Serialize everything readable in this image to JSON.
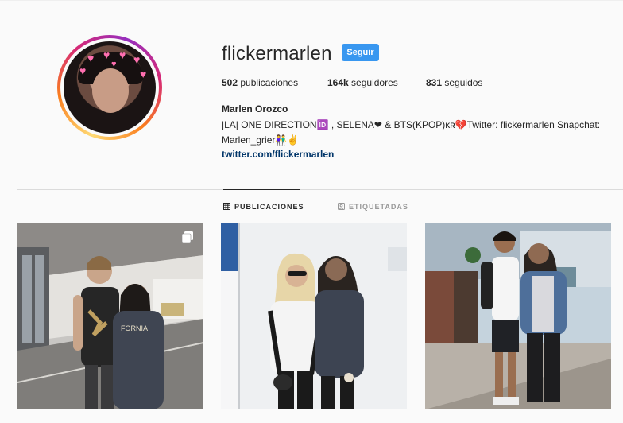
{
  "profile": {
    "username": "flickermarlen",
    "follow_label": "Seguir",
    "full_name": "Marlen Orozco",
    "bio_line1": "|LA| ONE DIRECTION🆔 , SELENA❤ & BTS(KPOP)ᴋʀ💔Twitter: flickermarlen Snapchat:",
    "bio_line2": "Marlen_grier👫✌",
    "link": "twitter.com/flickermarlen"
  },
  "stats": {
    "posts_count": "502",
    "posts_label": "publicaciones",
    "followers_count": "164k",
    "followers_label": "seguidores",
    "following_count": "831",
    "following_label": "seguidos"
  },
  "tabs": [
    {
      "label": "PUBLICACIONES",
      "icon": "grid-icon",
      "active": true
    },
    {
      "label": "ETIQUETADAS",
      "icon": "tag-icon",
      "active": false
    }
  ],
  "posts": [
    {
      "scene": "airport-terminal",
      "multi": true
    },
    {
      "scene": "white-wall-portrait",
      "multi": false
    },
    {
      "scene": "airport-hall",
      "multi": false
    }
  ],
  "colors": {
    "accent": "#3897f0",
    "link": "#003569",
    "background": "#fafafa"
  }
}
